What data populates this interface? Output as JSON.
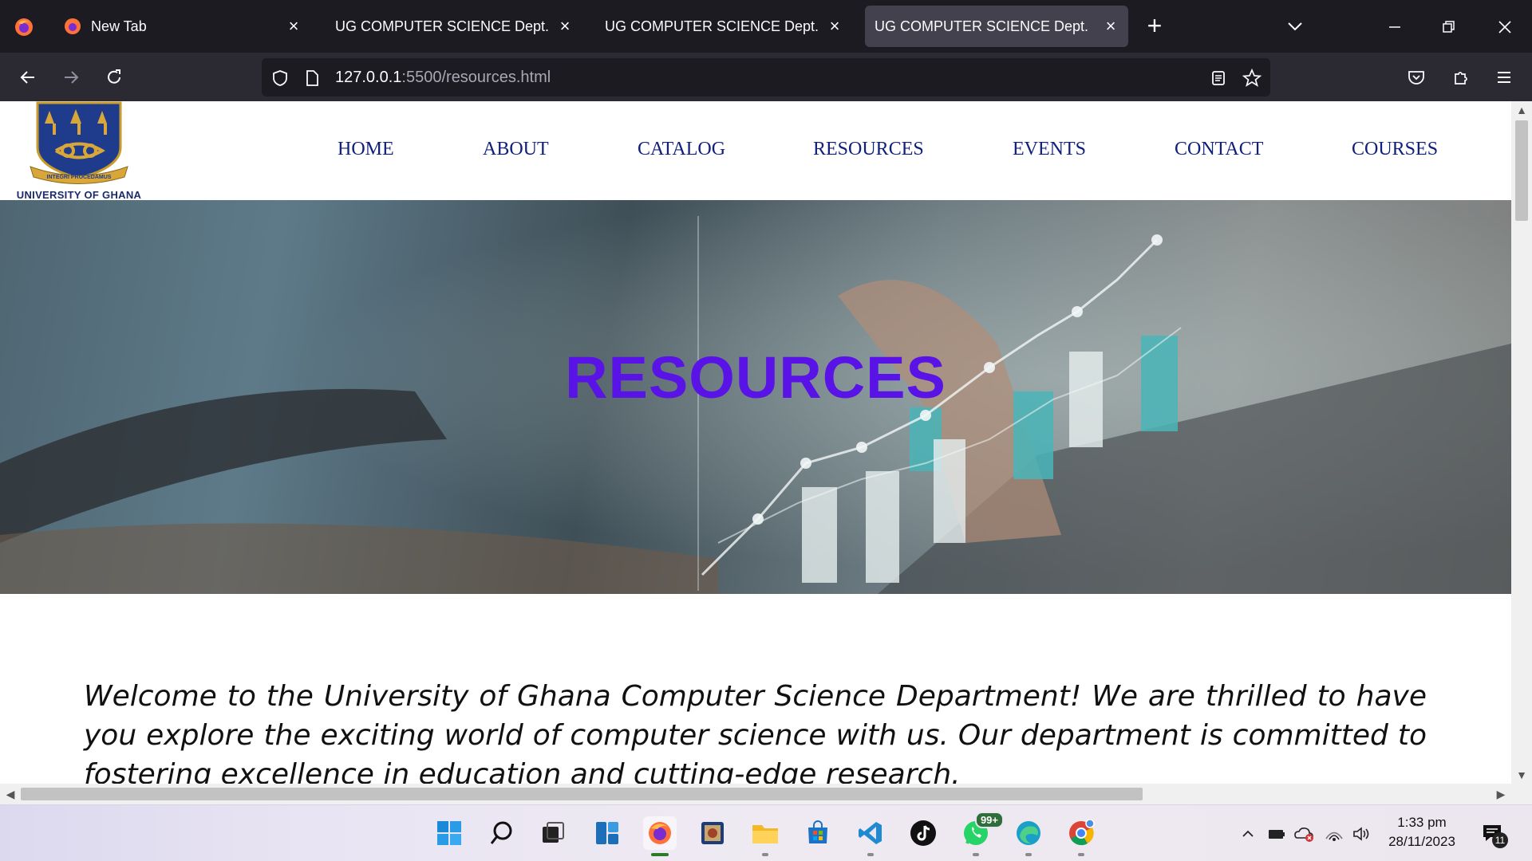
{
  "browser": {
    "tabs": [
      {
        "title": "New Tab",
        "active": false
      },
      {
        "title": "UG COMPUTER SCIENCE Dept.",
        "active": false
      },
      {
        "title": "UG COMPUTER SCIENCE Dept.",
        "active": false
      },
      {
        "title": "UG COMPUTER SCIENCE Dept.",
        "active": true
      }
    ],
    "url_host": "127.0.0.1",
    "url_rest": ":5500/resources.html"
  },
  "site": {
    "logo_text": "UNIVERSITY OF GHANA",
    "logo_motto": "INTEGRI PROCEDAMUS",
    "nav": [
      "HOME",
      "ABOUT",
      "CATALOG",
      "RESOURCES",
      "EVENTS",
      "CONTACT",
      "COURSES"
    ],
    "hero_title": "RESOURCES",
    "intro": "Welcome to the University of Ghana Computer Science Department! We are thrilled to have you explore the exciting world of computer science with us. Our department is committed to fostering excellence in education and cutting-edge research."
  },
  "taskbar": {
    "whatsapp_badge": "99+",
    "time": "1:33 pm",
    "date": "28/11/2023",
    "notifications": "11"
  },
  "colors": {
    "accent": "#5a13e6",
    "nav_text": "#0f1f7a",
    "chrome_dark": "#1c1b22",
    "chrome_toolbar": "#2b2a33"
  }
}
